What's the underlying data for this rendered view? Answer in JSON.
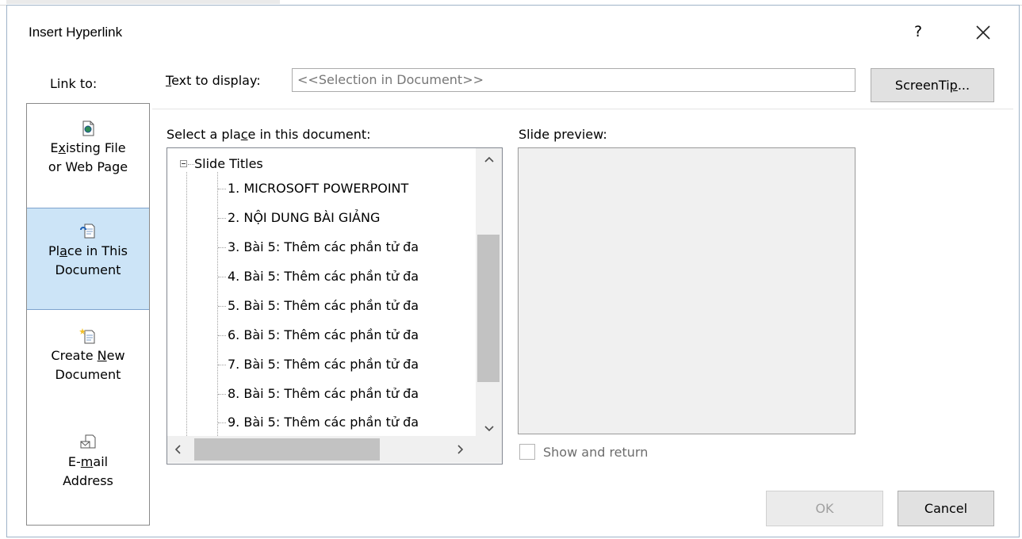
{
  "dialog": {
    "title": "Insert Hyperlink",
    "help_label": "?",
    "close_icon": "close-icon"
  },
  "link_to": {
    "label": "Link to:",
    "items": [
      {
        "pre": "E",
        "u": "x",
        "post": "isting File",
        "line2": "or Web Page",
        "icon": "existing-file-icon",
        "selected": false
      },
      {
        "pre": "Pl",
        "u": "a",
        "post": "ce in This",
        "line2": "Document",
        "icon": "place-in-document-icon",
        "selected": true
      },
      {
        "pre": "Create ",
        "u": "N",
        "post": "ew",
        "line2": "Document",
        "icon": "create-new-document-icon",
        "selected": false
      },
      {
        "pre": "E-",
        "u": "m",
        "post": "ail",
        "line2": "Address",
        "icon": "email-address-icon",
        "selected": false
      }
    ]
  },
  "text_to_display": {
    "label_u": "T",
    "label_rest": "ext to display:",
    "value": "<<Selection in Document>>"
  },
  "screentip": {
    "pre": "ScreenTi",
    "u": "p",
    "post": "..."
  },
  "place_section": {
    "label_pre": "Select a pla",
    "label_u": "c",
    "label_post": "e in this document:",
    "root": "Slide Titles",
    "items": [
      "1. MICROSOFT POWERPOINT",
      "2. NỘI DUNG BÀI GIẢNG",
      "3. Bài 5: Thêm các phần tử đa",
      "4. Bài 5: Thêm các phần tử đa",
      "5. Bài 5: Thêm các phần tử đa",
      "6. Bài 5: Thêm các phần tử đa",
      "7. Bài 5: Thêm các phần tử đa",
      "8. Bài 5: Thêm các phần tử đa",
      "9. Bài 5: Thêm các phần tử đa"
    ]
  },
  "preview": {
    "label": "Slide preview:",
    "show_and_return": "Show and return"
  },
  "buttons": {
    "ok": "OK",
    "cancel": "Cancel"
  }
}
